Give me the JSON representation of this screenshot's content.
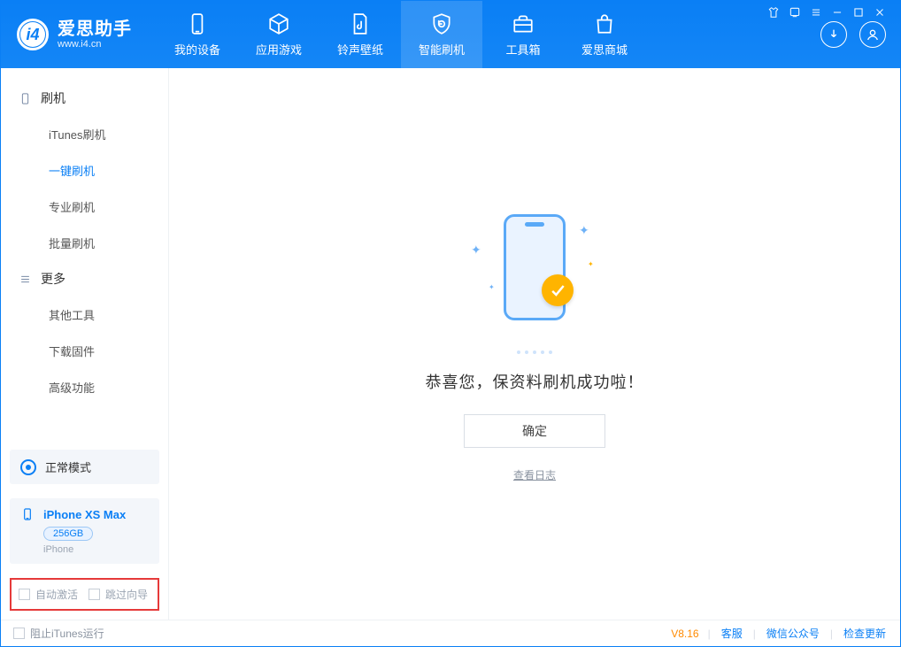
{
  "app": {
    "title": "爱思助手",
    "site": "www.i4.cn"
  },
  "tabs": [
    {
      "label": "我的设备"
    },
    {
      "label": "应用游戏"
    },
    {
      "label": "铃声壁纸"
    },
    {
      "label": "智能刷机"
    },
    {
      "label": "工具箱"
    },
    {
      "label": "爱思商城"
    }
  ],
  "sidebar": {
    "group1": {
      "title": "刷机",
      "items": [
        "iTunes刷机",
        "一键刷机",
        "专业刷机",
        "批量刷机"
      ]
    },
    "group2": {
      "title": "更多",
      "items": [
        "其他工具",
        "下载固件",
        "高级功能"
      ]
    }
  },
  "mode": {
    "label": "正常模式"
  },
  "device": {
    "name": "iPhone XS Max",
    "storage": "256GB",
    "type": "iPhone"
  },
  "checks": {
    "auto_activate": "自动激活",
    "skip_guide": "跳过向导"
  },
  "main": {
    "message": "恭喜您，保资料刷机成功啦！",
    "ok": "确定",
    "log": "查看日志"
  },
  "footer": {
    "block_itunes": "阻止iTunes运行",
    "version": "V8.16",
    "links": [
      "客服",
      "微信公众号",
      "检查更新"
    ]
  }
}
